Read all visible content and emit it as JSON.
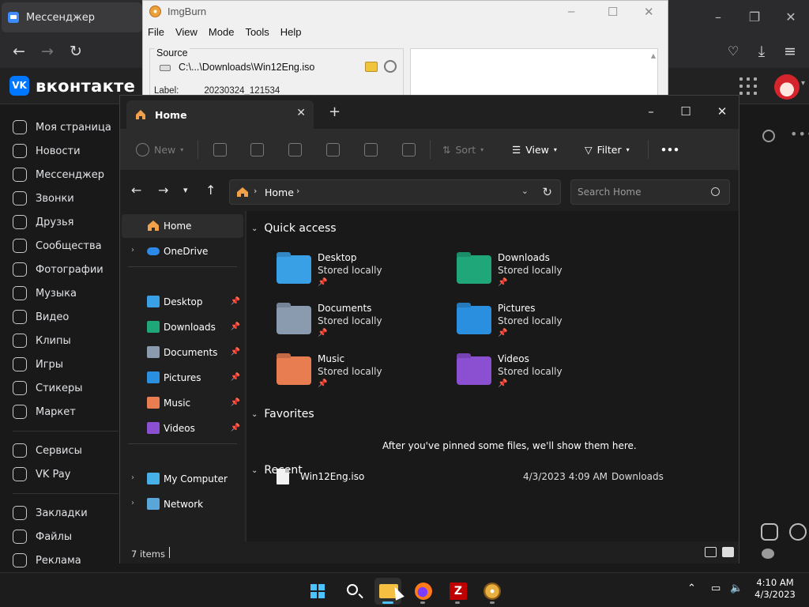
{
  "browser": {
    "tab_title": "Мессенджер",
    "brand": "вконтакте",
    "brand_mark": "VK",
    "window_controls": {
      "minimize": "–",
      "maximize": "❐",
      "close": "✕"
    },
    "nav_items": [
      {
        "label": "Моя страница",
        "icon": "user-icon"
      },
      {
        "label": "Новости",
        "icon": "news-icon"
      },
      {
        "label": "Мессенджер",
        "icon": "messenger-icon"
      },
      {
        "label": "Звонки",
        "icon": "phone-icon"
      },
      {
        "label": "Друзья",
        "icon": "friends-icon"
      },
      {
        "label": "Сообщества",
        "icon": "communities-icon"
      },
      {
        "label": "Фотографии",
        "icon": "photos-icon"
      },
      {
        "label": "Музыка",
        "icon": "music-icon"
      },
      {
        "label": "Видео",
        "icon": "video-icon"
      },
      {
        "label": "Клипы",
        "icon": "clips-icon"
      },
      {
        "label": "Игры",
        "icon": "games-icon"
      },
      {
        "label": "Стикеры",
        "icon": "stickers-icon"
      },
      {
        "label": "Маркет",
        "icon": "market-icon"
      }
    ],
    "nav_items_2": [
      {
        "label": "Сервисы",
        "icon": "services-icon"
      },
      {
        "label": "VK Pay",
        "icon": "vkpay-icon"
      }
    ],
    "nav_items_3": [
      {
        "label": "Закладки",
        "icon": "bookmarks-icon"
      },
      {
        "label": "Файлы",
        "icon": "files-icon"
      },
      {
        "label": "Реклама",
        "icon": "ads-icon"
      }
    ],
    "more_dots": "•••"
  },
  "imgburn": {
    "title": "ImgBurn",
    "menu": [
      "File",
      "View",
      "Mode",
      "Tools",
      "Help"
    ],
    "source_label": "Source",
    "source_path": "C:\\...\\Downloads\\Win12Eng.iso",
    "label_key": "Label:",
    "label_value": "20230324_121534"
  },
  "explorer": {
    "tab_title": "Home",
    "new_tab": "+",
    "tab_close": "✕",
    "commands": {
      "new": "New",
      "sort": "Sort",
      "view": "View",
      "filter": "Filter",
      "more": "•••"
    },
    "address": {
      "location": "Home"
    },
    "search": {
      "placeholder": "Search Home"
    },
    "nav": {
      "home": "Home",
      "onedrive": "OneDrive",
      "pinned": [
        "Desktop",
        "Downloads",
        "Documents",
        "Pictures",
        "Music",
        "Videos"
      ],
      "my_computer": "My Computer",
      "network": "Network"
    },
    "sections": {
      "quick_access": "Quick access",
      "favorites": "Favorites",
      "recent": "Recent"
    },
    "quick_access": [
      {
        "name": "Desktop",
        "status": "Stored locally",
        "color": "#3aa0e6"
      },
      {
        "name": "Downloads",
        "status": "Stored locally",
        "color": "#1fa77a"
      },
      {
        "name": "Documents",
        "status": "Stored locally",
        "color": "#8a9bb0"
      },
      {
        "name": "Pictures",
        "status": "Stored locally",
        "color": "#2b8fe0"
      },
      {
        "name": "Music",
        "status": "Stored locally",
        "color": "#e87d52"
      },
      {
        "name": "Videos",
        "status": "Stored locally",
        "color": "#8b4fd1"
      }
    ],
    "favorites_empty": "After you've pinned some files, we'll show them here.",
    "recent": [
      {
        "name": "Win12Eng.iso",
        "date": "4/3/2023 4:09 AM",
        "location": "Downloads"
      }
    ],
    "status": {
      "count": "7 items"
    }
  },
  "taskbar": {
    "time": "4:10 AM",
    "date": "4/3/2023",
    "apps": [
      "start",
      "search",
      "file-explorer",
      "firefox",
      "filezilla",
      "imgburn"
    ],
    "filezilla_glyph": "Z"
  },
  "colors": {
    "accent": "#4cc2ff",
    "vk_blue": "#0077ff",
    "explorer_bg": "#191919"
  }
}
